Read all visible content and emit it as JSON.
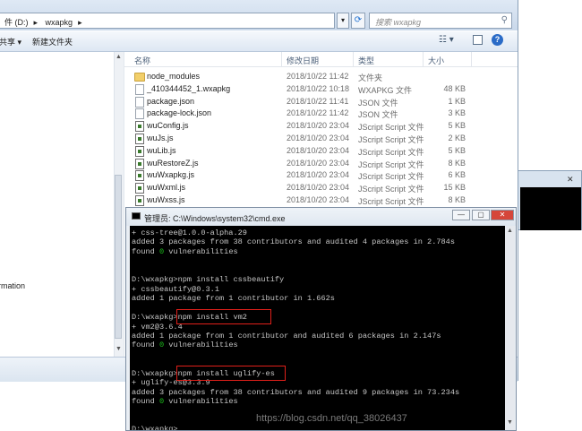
{
  "explorer": {
    "breadcrumb": [
      "件 (D:)",
      "wxapkg"
    ],
    "search_placeholder": "搜索 wxapkg",
    "toolbar": {
      "share_label": "共享 ▾",
      "new_folder_label": "新建文件夹"
    },
    "nav_item_label": "rmation",
    "columns": {
      "name": "名称",
      "date": "修改日期",
      "type": "类型",
      "size": "大小"
    },
    "files": [
      {
        "name": "node_modules",
        "date": "2018/10/22 11:42",
        "type": "文件夹",
        "size": "",
        "icon": "folder"
      },
      {
        "name": "_410344452_1.wxapkg",
        "date": "2018/10/22 10:18",
        "type": "WXAPKG 文件",
        "size": "48 KB",
        "icon": "doc"
      },
      {
        "name": "package.json",
        "date": "2018/10/22 11:41",
        "type": "JSON 文件",
        "size": "1 KB",
        "icon": "doc"
      },
      {
        "name": "package-lock.json",
        "date": "2018/10/22 11:42",
        "type": "JSON 文件",
        "size": "3 KB",
        "icon": "doc"
      },
      {
        "name": "wuConfig.js",
        "date": "2018/10/20 23:04",
        "type": "JScript Script 文件",
        "size": "5 KB",
        "icon": "js"
      },
      {
        "name": "wuJs.js",
        "date": "2018/10/20 23:04",
        "type": "JScript Script 文件",
        "size": "2 KB",
        "icon": "js"
      },
      {
        "name": "wuLib.js",
        "date": "2018/10/20 23:04",
        "type": "JScript Script 文件",
        "size": "5 KB",
        "icon": "js"
      },
      {
        "name": "wuRestoreZ.js",
        "date": "2018/10/20 23:04",
        "type": "JScript Script 文件",
        "size": "8 KB",
        "icon": "js"
      },
      {
        "name": "wuWxapkg.js",
        "date": "2018/10/20 23:04",
        "type": "JScript Script 文件",
        "size": "6 KB",
        "icon": "js"
      },
      {
        "name": "wuWxml.js",
        "date": "2018/10/20 23:04",
        "type": "JScript Script 文件",
        "size": "15 KB",
        "icon": "js"
      },
      {
        "name": "wuWxss.js",
        "date": "2018/10/20 23:04",
        "type": "JScript Script 文件",
        "size": "8 KB",
        "icon": "js"
      }
    ]
  },
  "cmd": {
    "title": "管理员: C:\\Windows\\system32\\cmd.exe",
    "lines": [
      {
        "text": "+ css-tree@1.0.0-alpha.29"
      },
      {
        "text": "added 3 packages from 38 contributors and audited 4 packages in 2.784s"
      },
      {
        "pre": "found ",
        "num": "0",
        "post": " vulnerabilities"
      },
      {
        "text": ""
      },
      {
        "text": ""
      },
      {
        "text": "D:\\wxapkg>npm install cssbeautify"
      },
      {
        "text": "+ cssbeautify@0.3.1"
      },
      {
        "text": "added 1 package from 1 contributor in 1.662s"
      },
      {
        "text": ""
      },
      {
        "text": "D:\\wxapkg>npm install vm2"
      },
      {
        "text": "+ vm2@3.6.4"
      },
      {
        "text": "added 1 package from 1 contributor and audited 6 packages in 2.147s"
      },
      {
        "pre": "found ",
        "num": "0",
        "post": " vulnerabilities"
      },
      {
        "text": ""
      },
      {
        "text": ""
      },
      {
        "text": "D:\\wxapkg>npm install uglify-es"
      },
      {
        "text": "+ uglify-es@3.3.9"
      },
      {
        "text": "added 3 packages from 38 contributors and audited 9 packages in 73.234s"
      },
      {
        "pre": "found ",
        "num": "0",
        "post": " vulnerabilities"
      },
      {
        "text": ""
      },
      {
        "text": ""
      },
      {
        "text": "D:\\wxapkg>"
      }
    ]
  },
  "watermark": "https://blog.csdn.net/qq_38026437"
}
